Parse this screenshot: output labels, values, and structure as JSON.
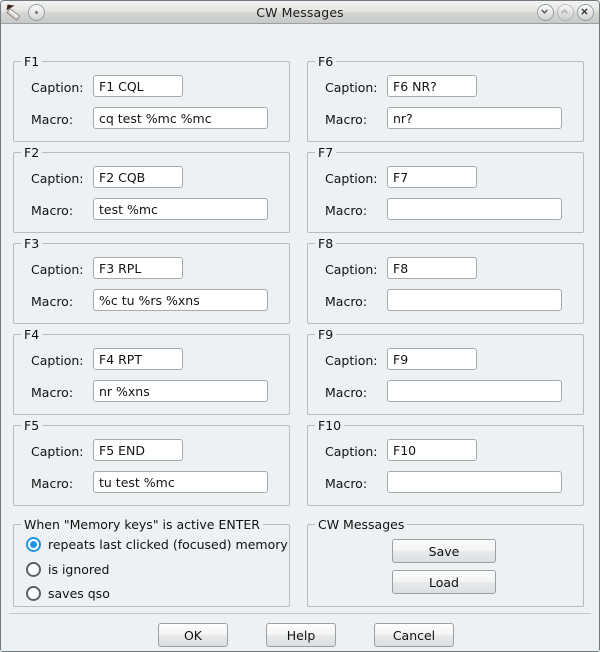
{
  "window": {
    "title": "CW Messages",
    "icons": {
      "app": "pen-icon",
      "menu": "window-menu-icon",
      "minimize": "chevron-down-icon",
      "maximize": "chevron-up-icon",
      "close": "close-icon"
    }
  },
  "labels": {
    "caption": "Caption:",
    "macro": "Macro:"
  },
  "memory_groups": [
    {
      "key": "F1",
      "caption": "F1 CQL",
      "macro": "cq test %mc %mc"
    },
    {
      "key": "F2",
      "caption": "F2 CQB",
      "macro": "test %mc"
    },
    {
      "key": "F3",
      "caption": "F3 RPL",
      "macro": "%c tu %rs %xns"
    },
    {
      "key": "F4",
      "caption": "F4 RPT",
      "macro": "nr %xns"
    },
    {
      "key": "F5",
      "caption": "F5 END",
      "macro": "tu test %mc"
    },
    {
      "key": "F6",
      "caption": "F6 NR?",
      "macro": "nr?"
    },
    {
      "key": "F7",
      "caption": "F7",
      "macro": ""
    },
    {
      "key": "F8",
      "caption": "F8",
      "macro": ""
    },
    {
      "key": "F9",
      "caption": "F9",
      "macro": ""
    },
    {
      "key": "F10",
      "caption": "F10",
      "macro": ""
    }
  ],
  "enter_behavior": {
    "legend": "When \"Memory keys\" is active ENTER",
    "options": [
      {
        "label": "repeats last clicked (focused) memory",
        "selected": true
      },
      {
        "label": "is ignored",
        "selected": false
      },
      {
        "label": "saves qso",
        "selected": false
      }
    ]
  },
  "cw_messages_panel": {
    "legend": "CW Messages",
    "save_label": "Save",
    "load_label": "Load"
  },
  "dialog_buttons": {
    "ok": "OK",
    "help": "Help",
    "cancel": "Cancel"
  },
  "colors": {
    "window_bg": "#eef1f3",
    "accent": "#1f95e8",
    "field_bg": "#ffffff",
    "group_border": "#b7bcc0"
  }
}
